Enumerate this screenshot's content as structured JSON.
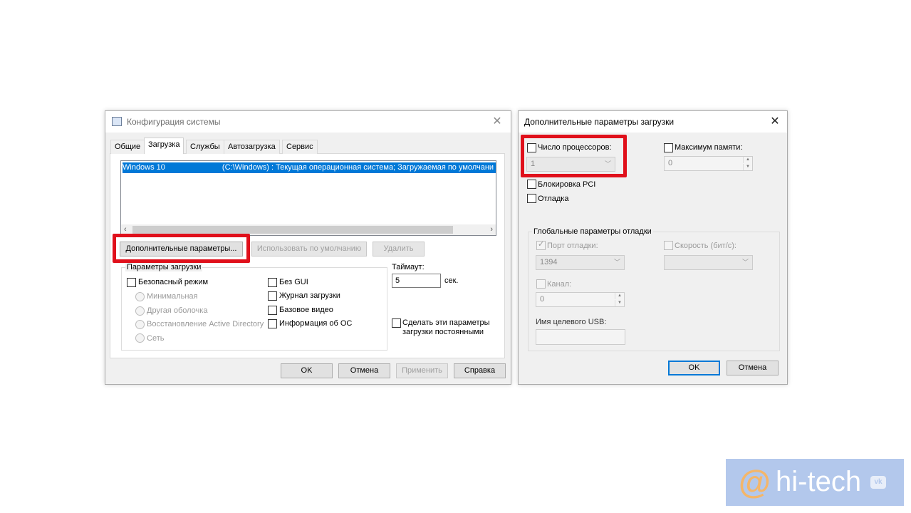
{
  "sysconfig": {
    "title": "Конфигурация системы",
    "tabs": [
      "Общие",
      "Загрузка",
      "Службы",
      "Автозагрузка",
      "Сервис"
    ],
    "os_entry_name": "Windows 10",
    "os_entry_rest": "(C:\\Windows) : Текущая операционная система; Загружаемая по умолчани",
    "buttons": {
      "advanced": "Дополнительные параметры...",
      "set_default": "Использовать по умолчанию",
      "delete": "Удалить",
      "ok": "OK",
      "cancel": "Отмена",
      "apply": "Применить",
      "help": "Справка"
    },
    "boot_options": {
      "title": "Параметры загрузки",
      "safe_boot": "Безопасный режим",
      "minimal": "Минимальная",
      "alternate_shell": "Другая оболочка",
      "ad_repair": "Восстановление Active Directory",
      "network": "Сеть",
      "no_gui": "Без GUI",
      "boot_log": "Журнал загрузки",
      "base_video": "Базовое видео",
      "os_info": "Информация  об ОС"
    },
    "timeout": {
      "label": "Таймаут:",
      "value": "5",
      "unit": "сек."
    },
    "make_permanent": "Сделать эти параметры загрузки постоянными"
  },
  "advanced": {
    "title": "Дополнительные параметры загрузки",
    "num_processors_label": "Число процессоров:",
    "num_processors_value": "1",
    "max_memory_label": "Максимум памяти:",
    "max_memory_value": "0",
    "pci_lock": "Блокировка PCI",
    "debug": "Отладка",
    "global_debug": {
      "title": "Глобальные параметры отладки",
      "debug_port_label": "Порт отладки:",
      "debug_port_value": "1394",
      "baud_rate_label": "Скорость (бит/с):",
      "channel_label": "Канал:",
      "channel_value": "0",
      "usb_target_label": "Имя целевого USB:"
    },
    "ok": "OK",
    "cancel": "Отмена"
  },
  "watermark": {
    "brand": "hi-tech",
    "symbol": "@"
  }
}
